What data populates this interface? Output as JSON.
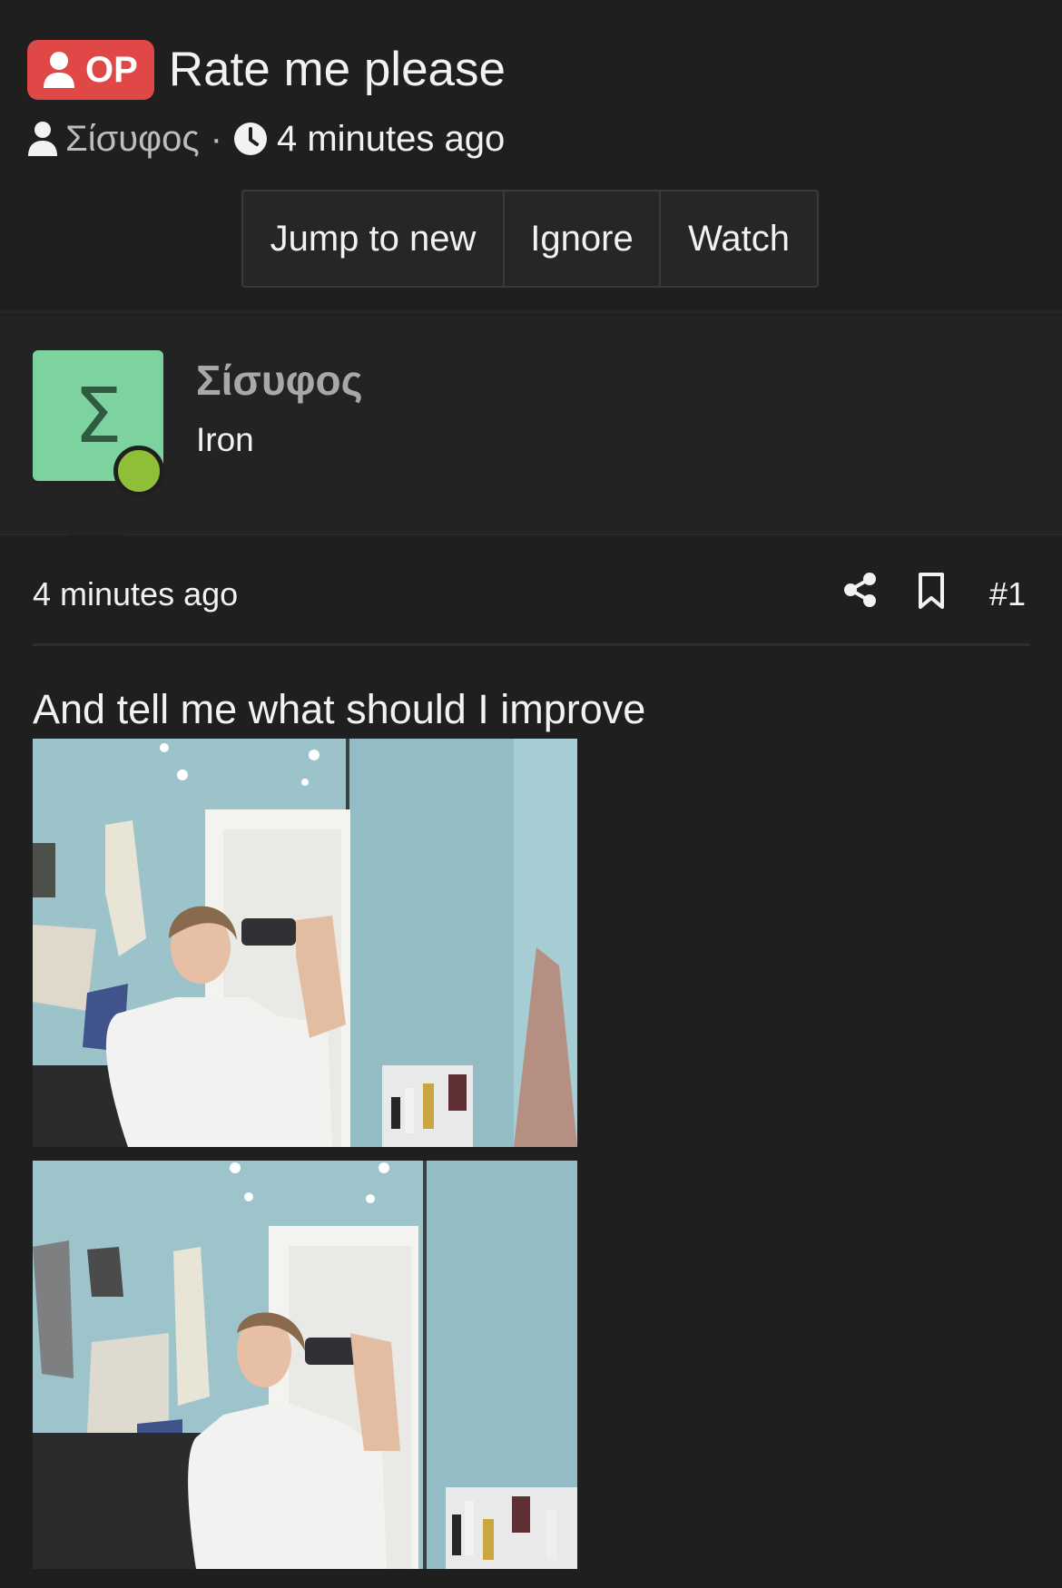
{
  "thread": {
    "badge_label": "OP",
    "title": "Rate me please",
    "author": "Σίσυφος",
    "separator": "·",
    "time": "4 minutes ago"
  },
  "actions": {
    "jump": "Jump to new",
    "ignore": "Ignore",
    "watch": "Watch"
  },
  "user": {
    "avatar_letter": "Σ",
    "name": "Σίσυφος",
    "rank": "Iron",
    "avatar_color": "#7dd3a0",
    "online_color": "#8fbf36"
  },
  "post": {
    "time": "4 minutes ago",
    "number": "#1",
    "body": "And tell me what should I improve"
  },
  "colors": {
    "background": "#1f1f1f",
    "op_badge": "#e04848",
    "muted_text": "#bdbdbd"
  }
}
